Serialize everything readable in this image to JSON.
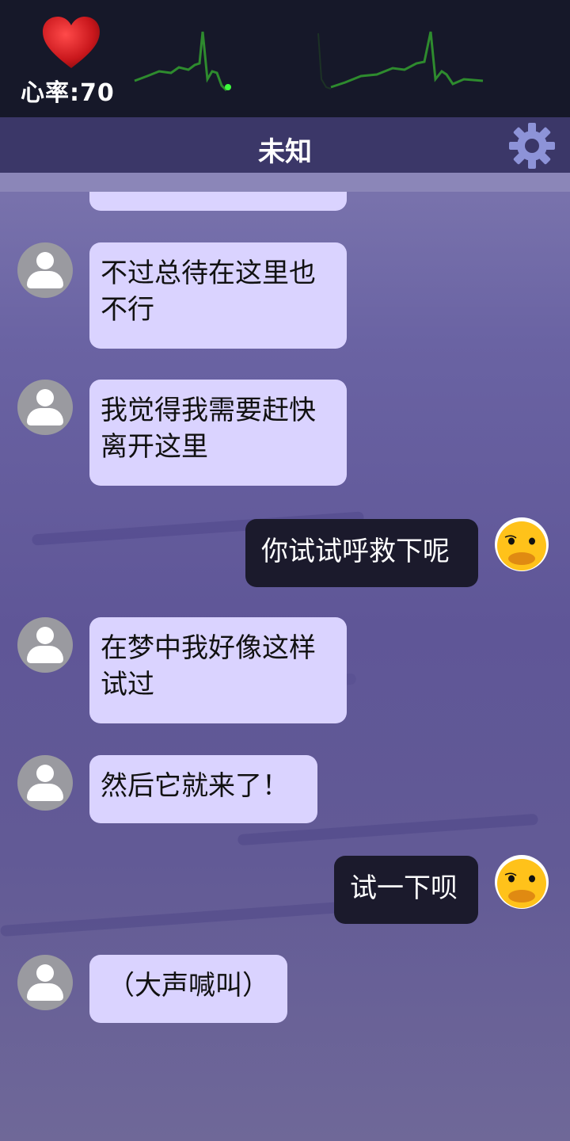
{
  "header": {
    "heart_rate_label": "心率:70",
    "contact_name": "未知"
  },
  "icons": {
    "heart": "heart-icon",
    "gear": "gear-icon",
    "avatar_incoming": "person-avatar-icon",
    "avatar_outgoing": "duck-avatar-icon"
  },
  "colors": {
    "topbar": "#161829",
    "titlebar": "#3b3768",
    "ecg_line": "#2e8b2e",
    "incoming_bubble": "#dad3ff",
    "outgoing_bubble": "#1b1a2c",
    "gear": "#8d93d8",
    "heart": "#c9171c"
  },
  "messages": [
    {
      "from": "contact",
      "text": ""
    },
    {
      "from": "contact",
      "text": "不过总待在这里也不行"
    },
    {
      "from": "contact",
      "text": "我觉得我需要赶快离开这里"
    },
    {
      "from": "me",
      "text": "你试试呼救下呢"
    },
    {
      "from": "contact",
      "text": "在梦中我好像这样试过"
    },
    {
      "from": "contact",
      "text": "然后它就来了！"
    },
    {
      "from": "me",
      "text": "试一下呗"
    },
    {
      "from": "contact",
      "text": "（大声喊叫）"
    }
  ]
}
